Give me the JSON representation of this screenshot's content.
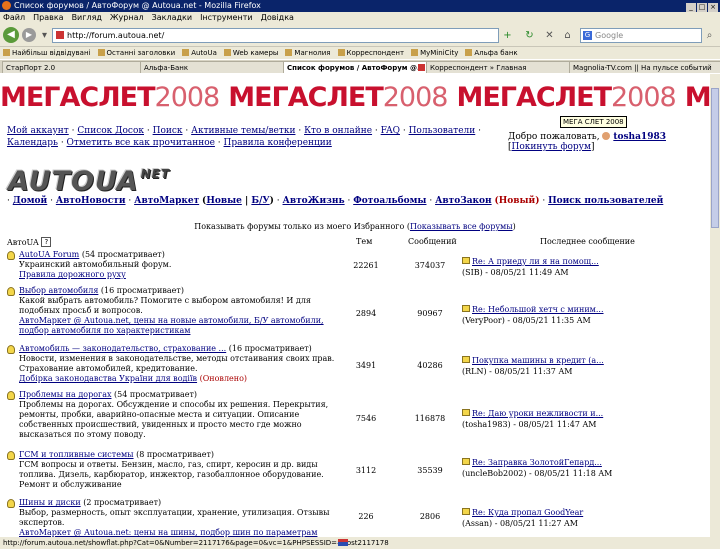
{
  "window": {
    "title": "Список форумов / АвтоФорум @ Autoua.net - Mozilla Firefox"
  },
  "menu": [
    "Файл",
    "Правка",
    "Вигляд",
    "Журнал",
    "Закладки",
    "Інструменти",
    "Довідка"
  ],
  "navigation": {
    "url": "http://forum.autoua.net/",
    "search_placeholder": "Google"
  },
  "bookmarks": [
    "Найбільш відвідувані",
    "Останні заголовки",
    "AutoUa",
    "Web камеры",
    "Магнолия",
    "Корреспондент",
    "MyMiniCity",
    "Альфа банк"
  ],
  "tabs": [
    "СтарПорт 2.0",
    "Альфа-Банк",
    "Список форумов / АвтоФорум @...",
    "Корреспондент » Главная",
    "Magnolia-TV.com || На пульсе событий"
  ],
  "banner": {
    "bold": "МЕГАСЛЕТ",
    "year": "2008",
    "tooltip": "МЕГА СЛЕТ 2008"
  },
  "header_links": {
    "items": [
      "Мой аккаунт",
      "Список Досок",
      "Поиск",
      "Активные темы/ветки",
      "Кто в онлайне",
      "FAQ",
      "Пользователи",
      "Календарь",
      "Отметить все как прочитанное",
      "Правила конференции"
    ],
    "welcome_prefix": "Добро пожаловать,",
    "username": "tosha1983",
    "logout": "Покинуть форум"
  },
  "logo": {
    "text": "AUTOUA",
    "suffix": "NET"
  },
  "site_nav": {
    "home": "Домой",
    "news": "АвтоНовости",
    "market": "АвтоМаркет",
    "market_new": "Новые",
    "market_used": "Б/У",
    "life": "АвтоЖизнь",
    "photos": "Фотоальбомы",
    "law": "АвтоЗакон",
    "law_badge": "(Новый)",
    "users": "Поиск пользователей"
  },
  "favorites": {
    "text": "Показывать форумы только из моего Избранного (",
    "link": "Показывать все форумы",
    "end": ")"
  },
  "table": {
    "col_group": "AвтоUA",
    "col_topics": "Тем",
    "col_posts": "Сообщений",
    "col_last": "Последнее сообщение"
  },
  "forums": [
    {
      "title": "AutoUA Forum",
      "views": " (54 просматривает)",
      "description": "Украинский автомобильный форум.",
      "sublinks": "Правила дорожного руху",
      "sublinks_extra": "",
      "topics": "22261",
      "posts": "374037",
      "last_title": "Re: А приеду ли я на помощ...",
      "last_meta": "(SIB) - 08/05/21 11:49 AM"
    },
    {
      "title": "Выбор автомобиля",
      "views": " (16 просматривает)",
      "description": "Какой выбрать автомобиль? Помогите с выбором автомобиля! И для подобных просьб и вопросов.",
      "sublinks": "АвтоМаркет @ Autoua.net, цены на новые автомобили, Б/У автомобили, подбор автомобиля по характеристикам",
      "sublinks_extra": "",
      "topics": "2894",
      "posts": "90967",
      "last_title": "Re: Небольшой хетч с миним...",
      "last_meta": "(VeryPoor) - 08/05/21 11:35 AM"
    },
    {
      "title": "Автомобиль — законодательство, страхование ...",
      "views": " (16 просматривает)",
      "description": "Новости, изменения в законодательстве, методы отстаивания своих прав. Страхование автомобилей, кредитование.",
      "sublinks": "Добірка законодавства України для водіїв",
      "sublinks_extra": " (Оновлено)",
      "topics": "3491",
      "posts": "40286",
      "last_title": "Покупка машины в кредит (а...",
      "last_meta": "(RLN) - 08/05/21 11:37 AM"
    },
    {
      "title": "Проблемы на дорогах",
      "views": " (54 просматривает)",
      "description": "Проблемы на дорогах. Обсуждение и способы их решения. Перекрытия, ремонты, пробки, аварийно-опасные места и ситуации. Описание собственных происшествий, увиденных и просто место где можно высказаться по этому поводу.",
      "sublinks": "",
      "sublinks_extra": "",
      "topics": "7546",
      "posts": "116878",
      "last_title": "Re: Даю уроки нежливости и...",
      "last_meta": "(tosha1983) - 08/05/21 11:47 AM"
    },
    {
      "title": "ГСМ и топливные системы",
      "views": " (8 просматривает)",
      "description": "ГСМ вопросы и ответы. Бензин, масло, газ, спирт, керосин и др. виды топлива. Дизель, карбюратор, инжектор, газобаллонное оборудование. Ремонт и обслуживание",
      "sublinks": "",
      "sublinks_extra": "",
      "topics": "3112",
      "posts": "35539",
      "last_title": "Re: Заправка ЗолотойГепард...",
      "last_meta": "(uncleBob2002) - 08/05/21 11:18 AM"
    },
    {
      "title": "Шины и диски",
      "views": " (2 просматривает)",
      "description": "Выбор, размерность, опыт эксплуатации, хранение, утилизация. Отзывы экспертов.",
      "sublinks": "АвтоМаркет @ Autoua.net: цены на шины, подбор шин по параметрам",
      "sublinks_extra": "",
      "topics": "226",
      "posts": "2806",
      "last_title": "Re: Куда пропал GoodYear",
      "last_meta": "(Assan) - 08/05/21 11:27 AM"
    }
  ],
  "status": {
    "text": "http://forum.autoua.net/showflat.php?Cat=0&Number=2117176&page=0&vc=1&PHPSESSID=#Post2117178"
  }
}
